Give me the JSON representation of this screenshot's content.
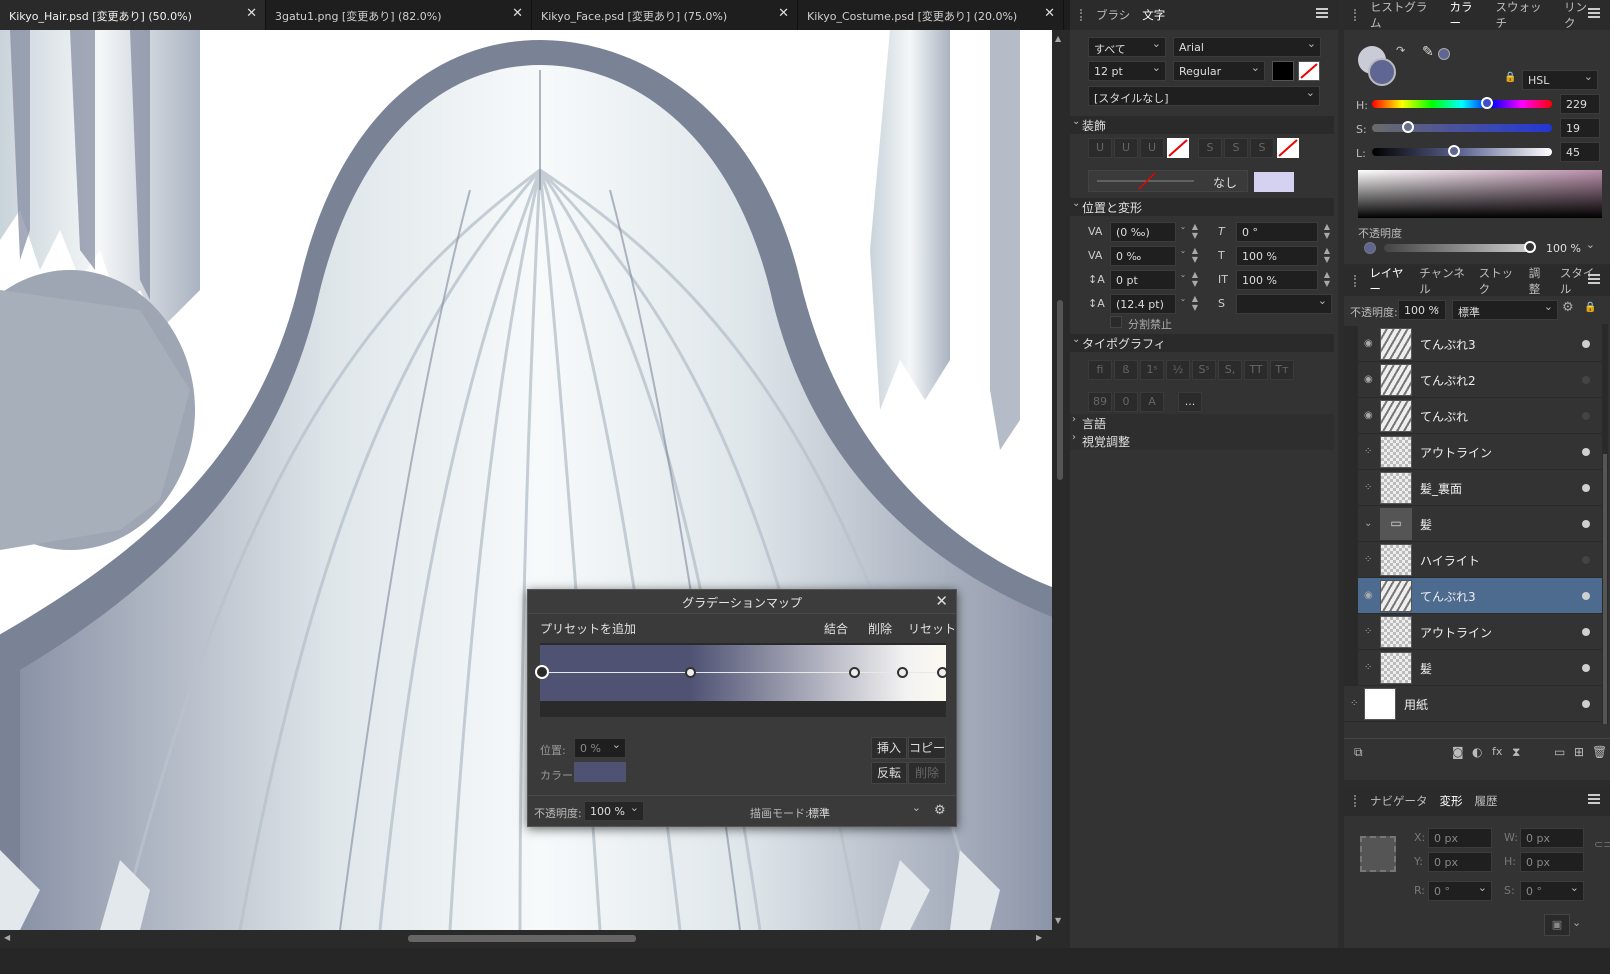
{
  "tabs": [
    {
      "label": "Kikyo_Hair.psd [変更あり] (50.0%)"
    },
    {
      "label": "3gatu1.png [変更あり] (82.0%)"
    },
    {
      "label": "Kikyo_Face.psd [変更あり] (75.0%)"
    },
    {
      "label": "Kikyo_Costume.psd [変更あり] (20.0%)"
    }
  ],
  "close_glyph": "✕",
  "text_panel": {
    "tabs": [
      "ブラシ",
      "文字"
    ],
    "scope": "すべて",
    "font": "Arial",
    "size": "12 pt",
    "weight": "Regular",
    "style": "[スタイルなし]",
    "decoration_header": "装飾",
    "deco_none": "なし",
    "position_header": "位置と変形",
    "fields": {
      "kerning": "(0 ‰)",
      "tracking": "0 ‰",
      "baseline": "0 pt",
      "leading": "(12.4 pt)",
      "shear": "0 °",
      "hscale": "100 %",
      "vscale": "100 %",
      "skew": ""
    },
    "no_break": "分割禁止",
    "typography_header": "タイポグラフィ",
    "more": "...",
    "language_header": "言語",
    "visual_header": "視覚調整"
  },
  "color_panel": {
    "tabs": [
      "ヒストグラム",
      "カラー",
      "スウォッチ",
      "リンク"
    ],
    "mode": "HSL",
    "h_label": "H:",
    "h": "229",
    "s_label": "S:",
    "s": "19",
    "l_label": "L:",
    "l": "45",
    "opacity_label": "不透明度",
    "opacity": "100 %",
    "current_color": "#5f6694"
  },
  "layers_panel": {
    "tabs": [
      "レイヤー",
      "チャンネル",
      "ストック",
      "調整",
      "スタイル"
    ],
    "opacity_label": "不透明度:",
    "opacity": "100 %",
    "blend": "標準",
    "layers": [
      {
        "name": "てんぷれ3",
        "type": "brush",
        "visible": true
      },
      {
        "name": "てんぷれ2",
        "type": "brush",
        "visible": false
      },
      {
        "name": "てんぷれ",
        "type": "brush",
        "visible": false
      },
      {
        "name": "アウトライン",
        "type": "pixel",
        "visible": true
      },
      {
        "name": "髪_裏面",
        "type": "pixel",
        "visible": true
      },
      {
        "name": "髪",
        "type": "group",
        "visible": true
      },
      {
        "name": "ハイライト",
        "type": "pixel",
        "visible": false
      },
      {
        "name": "てんぷれ3",
        "type": "brush",
        "visible": true,
        "selected": true
      },
      {
        "name": "アウトライン",
        "type": "pixel",
        "visible": true
      },
      {
        "name": "髪",
        "type": "pixel",
        "visible": true
      },
      {
        "name": "用紙",
        "type": "white",
        "visible": true
      }
    ]
  },
  "transform_panel": {
    "tabs": [
      "ナビゲータ",
      "変形",
      "履歴"
    ],
    "x_label": "X:",
    "x": "0 px",
    "w_label": "W:",
    "w": "0 px",
    "y_label": "Y:",
    "y": "0 px",
    "h_label": "H:",
    "h": "0 px",
    "r_label": "R:",
    "r": "0 °",
    "s_label": "S:",
    "s": "0 °"
  },
  "gradient_dialog": {
    "title": "グラデーションマップ",
    "add_preset": "プリセットを追加",
    "merge": "結合",
    "delete": "削除",
    "reset": "リセット",
    "position_label": "位置:",
    "position": "0 %",
    "color_label": "カラー:",
    "insert": "挿入",
    "copy": "コピー",
    "reverse": "反転",
    "delete2": "削除",
    "opacity_label": "不透明度:",
    "opacity": "100 %",
    "blend_label": "描画モード:",
    "blend": "標準",
    "stops": [
      0,
      0.37,
      0.78,
      0.9,
      1.0
    ],
    "colors": [
      "#4f5273",
      "#4f5273",
      "#f2f2f2",
      "#fbf9f1"
    ]
  }
}
